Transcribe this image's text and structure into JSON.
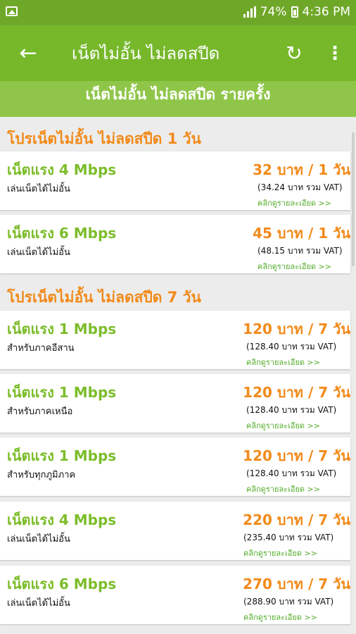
{
  "status_bar": {
    "battery": "74%",
    "time": "4:36 PM"
  },
  "app_bar": {
    "back": "←",
    "title": "เน็ตไม่อั้น ไม่ลดสปีด",
    "refresh": "↻",
    "more": "⋮"
  },
  "banner": "เน็ตไม่อั้น ไม่ลดสปีด รายครั้ง",
  "sections": [
    {
      "title": "โปรเน็ตไม่อั้น ไม่ลดสปีด 1 วัน"
    },
    {
      "title": "โปรเน็ตไม่อั้น ไม่ลดสปีด 7 วัน"
    }
  ],
  "cards": [
    {
      "speed": "เน็ตแรง 4 Mbps",
      "desc": "เล่นเน็ตได้ไม่อั้น",
      "price": "32 บาท / 1 วัน",
      "vat": "(34.24 บาท รวม VAT)",
      "link": "คลิกดูรายละเอียด >>"
    },
    {
      "speed": "เน็ตแรง 6 Mbps",
      "desc": "เล่นเน็ตได้ไม่อั้น",
      "price": "45 บาท / 1 วัน",
      "vat": "(48.15 บาท รวม VAT)",
      "link": "คลิกดูรายละเอียด >>"
    },
    {
      "speed": "เน็ตแรง 1 Mbps",
      "desc": "สำหรับภาคอีสาน",
      "price": "120 บาท / 7 วัน",
      "vat": "(128.40 บาท รวม VAT)",
      "link": "คลิกดูรายละเอียด >>"
    },
    {
      "speed": "เน็ตแรง 1 Mbps",
      "desc": "สำหรับภาคเหนือ",
      "price": "120 บาท / 7 วัน",
      "vat": "(128.40 บาท รวม VAT)",
      "link": "คลิกดูรายละเอียด >>"
    },
    {
      "speed": "เน็ตแรง 1 Mbps",
      "desc": "สำหรับทุกภูมิภาค",
      "price": "120 บาท / 7 วัน",
      "vat": "(128.40 บาท รวม VAT)",
      "link": "คลิกดูรายละเอียด >>"
    },
    {
      "speed": "เน็ตแรง 4 Mbps",
      "desc": "เล่นเน็ตได้ไม่อั้น",
      "price": "220 บาท / 7 วัน",
      "vat": "(235.40 บาท รวม VAT)",
      "link": "คลิกดูรายละเอียด >>"
    },
    {
      "speed": "เน็ตแรง 6 Mbps",
      "desc": "เล่นเน็ตได้ไม่อั้น",
      "price": "270 บาท / 7 วัน",
      "vat": "(288.90 บาท รวม VAT)",
      "link": "คลิกดูรายละเอียด >>"
    }
  ]
}
